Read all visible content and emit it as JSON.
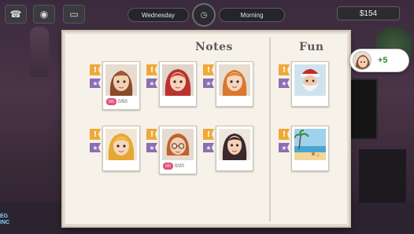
{
  "hud": {
    "day": "Wednesday",
    "time_of_day": "Morning",
    "money": "$154"
  },
  "panel": {
    "notes_title": "Notes",
    "fun_title": "Fun"
  },
  "cards": [
    {
      "name": "card-brown-hair-girl",
      "progress": "0/50",
      "heart": "0/5"
    },
    {
      "name": "card-red-hair-girl"
    },
    {
      "name": "card-ginger-girl"
    },
    {
      "name": "card-santa"
    },
    {
      "name": "card-blonde-girl"
    },
    {
      "name": "card-glasses-girl",
      "progress": "0/20",
      "heart": "0/0"
    },
    {
      "name": "card-dark-hair-girl"
    },
    {
      "name": "card-beach"
    }
  ],
  "popup": {
    "value": "+5"
  },
  "logo": {
    "text": "EG INC"
  },
  "colors": {
    "panel_bg": "#f6f2e9",
    "accent_orange": "#f0a838",
    "accent_purple": "#8b6fb0",
    "heart_pink": "#e0507a",
    "positive_green": "#2f8a3a"
  },
  "icons": [
    "phone-icon",
    "camera-icon",
    "clock-icon",
    "exclamation-pin-icon",
    "star-pin-icon"
  ]
}
